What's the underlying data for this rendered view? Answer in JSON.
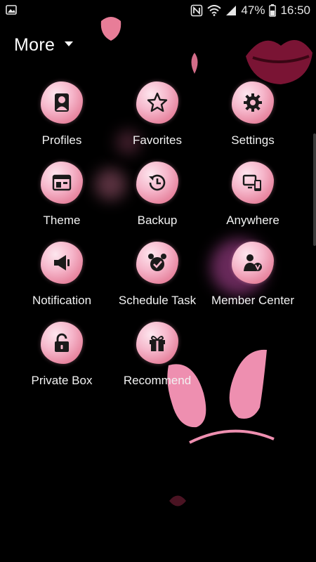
{
  "status_bar": {
    "battery": "47%",
    "time": "16:50",
    "icons": [
      "gallery-icon",
      "nfc-icon",
      "wifi-icon",
      "signal-icon",
      "battery-icon"
    ]
  },
  "header": {
    "title": "More"
  },
  "apps": [
    {
      "label": "Profiles",
      "icon": "profile-icon"
    },
    {
      "label": "Favorites",
      "icon": "star-icon"
    },
    {
      "label": "Settings",
      "icon": "gear-icon"
    },
    {
      "label": "Theme",
      "icon": "theme-icon"
    },
    {
      "label": "Backup",
      "icon": "backup-icon"
    },
    {
      "label": "Anywhere",
      "icon": "anywhere-icon"
    },
    {
      "label": "Notification",
      "icon": "megaphone-icon"
    },
    {
      "label": "Schedule Task",
      "icon": "alarm-clock-icon"
    },
    {
      "label": "Member Center",
      "icon": "member-icon"
    },
    {
      "label": "Private Box",
      "icon": "lock-icon"
    },
    {
      "label": "Recommend",
      "icon": "gift-icon"
    }
  ],
  "colors": {
    "background": "#000000",
    "icon_pink": "#f6b8cc",
    "glyph": "#1a1a1a"
  }
}
